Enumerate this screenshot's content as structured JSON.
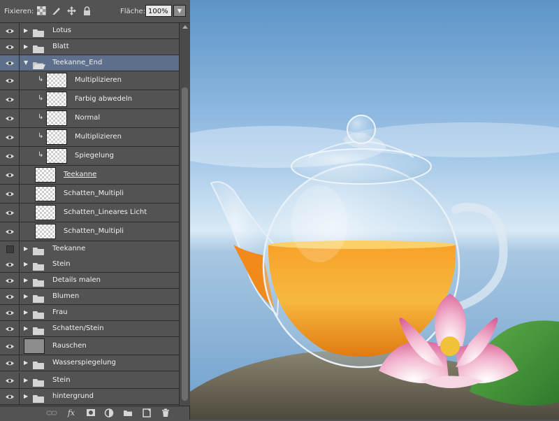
{
  "toolbar": {
    "lock_label": "Fixieren:",
    "fill_label": "Fläche:",
    "fill_value": "100%",
    "lock_icons": [
      "lock-transparent-pixels-icon",
      "lock-image-pixels-icon",
      "lock-position-icon",
      "lock-all-icon"
    ]
  },
  "layers": [
    {
      "name": "Lotus",
      "kind": "group",
      "visible": true,
      "expanded": false,
      "indent": 0,
      "selected": false
    },
    {
      "name": "Blatt",
      "kind": "group",
      "visible": true,
      "expanded": false,
      "indent": 0,
      "selected": false
    },
    {
      "name": "Teekanne_End",
      "kind": "group",
      "visible": true,
      "expanded": true,
      "indent": 0,
      "selected": true
    },
    {
      "name": "Multiplizieren",
      "kind": "layer",
      "visible": true,
      "clipped": true,
      "indent": 1
    },
    {
      "name": "Farbig abwedeln",
      "kind": "layer",
      "visible": true,
      "clipped": true,
      "indent": 1
    },
    {
      "name": "Normal",
      "kind": "layer",
      "visible": true,
      "clipped": true,
      "indent": 1
    },
    {
      "name": "Multiplizieren",
      "kind": "layer",
      "visible": true,
      "clipped": true,
      "indent": 1
    },
    {
      "name": "Spiegelung",
      "kind": "layer",
      "visible": true,
      "clipped": true,
      "indent": 1
    },
    {
      "name": "Teekanne",
      "kind": "layer",
      "visible": true,
      "clipped": false,
      "indent": 1,
      "underline": true
    },
    {
      "name": "Schatten_Multipli",
      "kind": "layer",
      "visible": true,
      "clipped": false,
      "indent": 1
    },
    {
      "name": "Schatten_Lineares Licht",
      "kind": "layer",
      "visible": true,
      "clipped": false,
      "indent": 1
    },
    {
      "name": "Schatten_Multipli",
      "kind": "layer",
      "visible": true,
      "clipped": false,
      "indent": 1
    },
    {
      "name": "Teekanne",
      "kind": "group",
      "visible": false,
      "expanded": false,
      "indent": 0
    },
    {
      "name": "Stein",
      "kind": "group",
      "visible": true,
      "expanded": false,
      "indent": 0
    },
    {
      "name": "Details malen",
      "kind": "group",
      "visible": true,
      "expanded": false,
      "indent": 0
    },
    {
      "name": "Blumen",
      "kind": "group",
      "visible": true,
      "expanded": false,
      "indent": 0
    },
    {
      "name": "Frau",
      "kind": "group",
      "visible": true,
      "expanded": false,
      "indent": 0
    },
    {
      "name": "Schatten/Stein",
      "kind": "group",
      "visible": true,
      "expanded": false,
      "indent": 0
    },
    {
      "name": "Rauschen",
      "kind": "fill",
      "visible": true,
      "indent": 0
    },
    {
      "name": "Wasserspiegelung",
      "kind": "group",
      "visible": true,
      "expanded": false,
      "indent": 0
    },
    {
      "name": "Stein",
      "kind": "group",
      "visible": true,
      "expanded": false,
      "indent": 0
    },
    {
      "name": "hintergrund",
      "kind": "group",
      "visible": true,
      "expanded": false,
      "indent": 0
    }
  ],
  "bottom_icons": [
    "link-layers-icon",
    "layer-style-fx-icon",
    "layer-mask-icon",
    "adjustment-layer-icon",
    "new-group-icon",
    "new-layer-icon",
    "delete-layer-icon"
  ],
  "colors": {
    "panel": "#535353",
    "selected": "#5d6f8a",
    "tea": "#f39a1c",
    "sky": "#7fb0dc",
    "lotus": "#e879a8"
  }
}
